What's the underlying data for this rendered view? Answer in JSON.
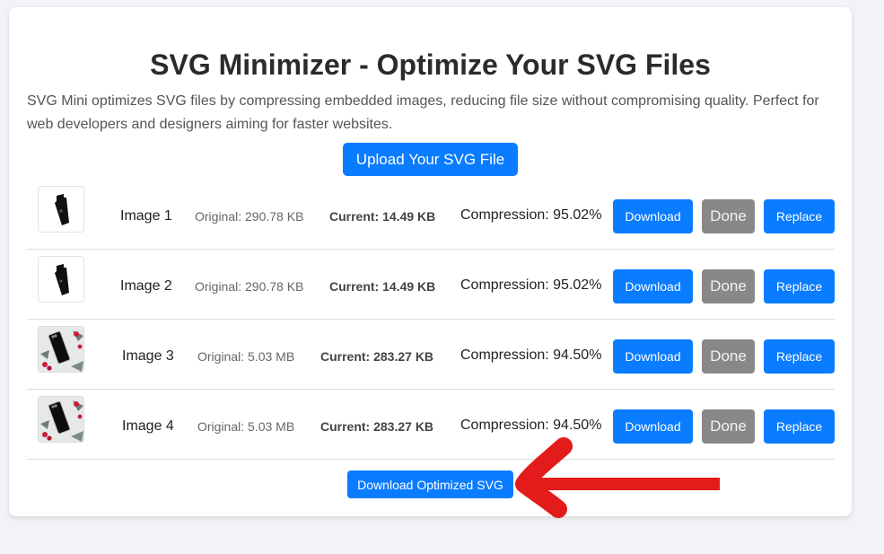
{
  "header": {
    "title": "SVG Minimizer - Optimize Your SVG Files",
    "description": "SVG Mini optimizes SVG files by compressing embedded images, reducing file size without compromising quality. Perfect for web developers and designers aiming for faster websites."
  },
  "upload_button": "Upload Your SVG File",
  "images": [
    {
      "name": "Image 1",
      "original": "Original: 290.78 KB",
      "current": "Current: 14.49 KB",
      "compression": "Compression: 95.02%",
      "thumb": "phone-case-icon",
      "download": "Download",
      "status": "Done",
      "replace": "Replace"
    },
    {
      "name": "Image 2",
      "original": "Original: 290.78 KB",
      "current": "Current: 14.49 KB",
      "compression": "Compression: 95.02%",
      "thumb": "phone-case-icon",
      "download": "Download",
      "status": "Done",
      "replace": "Replace"
    },
    {
      "name": "Image 3",
      "original": "Original: 5.03 MB",
      "current": "Current: 283.27 KB",
      "compression": "Compression: 94.50%",
      "thumb": "phone-photo-icon",
      "download": "Download",
      "status": "Done",
      "replace": "Replace"
    },
    {
      "name": "Image 4",
      "original": "Original: 5.03 MB",
      "current": "Current: 283.27 KB",
      "compression": "Compression: 94.50%",
      "thumb": "phone-photo-icon",
      "download": "Download",
      "status": "Done",
      "replace": "Replace"
    }
  ],
  "download_all_button": "Download Optimized SVG",
  "colors": {
    "primary": "#0a7cff",
    "done": "#888888",
    "annotation_arrow": "#e31b1b"
  }
}
